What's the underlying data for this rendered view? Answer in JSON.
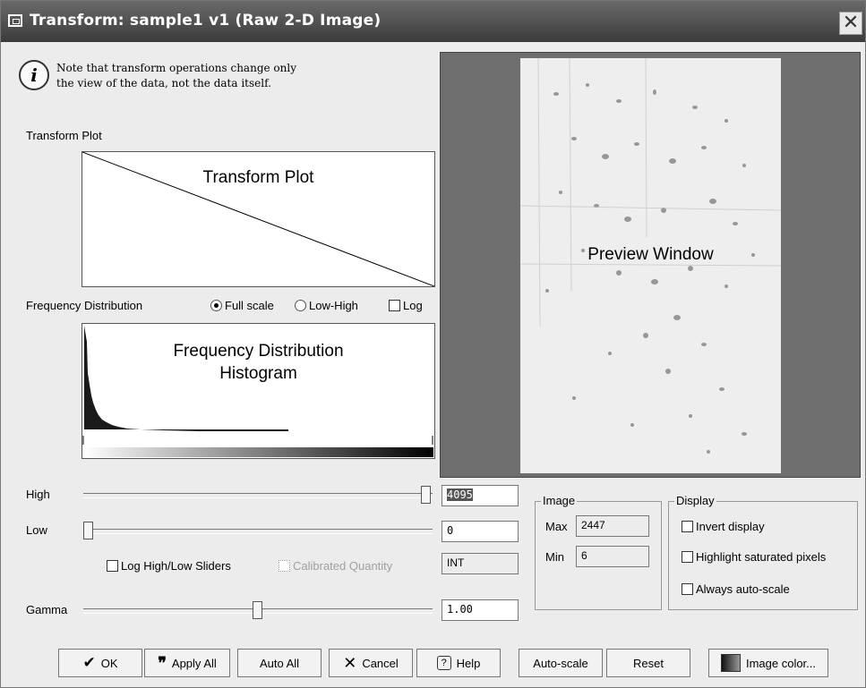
{
  "window": {
    "title": "Transform: sample1 v1 (Raw 2-D Image)",
    "close_glyph": "✕"
  },
  "note": {
    "icon": "info-icon",
    "icon_glyph": "i",
    "line1": "Note that transform operations change only",
    "line2": "the view of the data, not the data itself."
  },
  "transform_plot": {
    "label": "Transform Plot",
    "overlay": "Transform Plot"
  },
  "frequency": {
    "label": "Frequency Distribution",
    "radio_full": "Full scale",
    "radio_lowhigh": "Low-High",
    "log_label": "Log",
    "overlay_line1": "Frequency Distribution",
    "overlay_line2": "Histogram"
  },
  "preview": {
    "overlay": "Preview Window"
  },
  "controls": {
    "high_label": "High",
    "high_value": "4095",
    "high_level": 1.0,
    "low_label": "Low",
    "low_value": "0",
    "low_level": 0.0,
    "log_sliders_label": "Log High/Low Sliders",
    "calibrated_label": "Calibrated Quantity",
    "quantity_value": "INT",
    "gamma_label": "Gamma",
    "gamma_value": "1.00"
  },
  "image_group": {
    "title": "Image",
    "max_label": "Max",
    "max_value": "2447",
    "min_label": "Min",
    "min_value": "6"
  },
  "display_group": {
    "title": "Display",
    "invert": "Invert display",
    "highlight": "Highlight saturated pixels",
    "autoscale": "Always auto-scale"
  },
  "buttons": {
    "ok": "OK",
    "apply_all": "Apply All",
    "auto_all": "Auto All",
    "cancel": "Cancel",
    "help": "Help",
    "auto_scale": "Auto-scale",
    "reset": "Reset",
    "image_color": "Image color..."
  },
  "colors": {
    "titlebar": "#4a4a4a",
    "preview_frame": "#6e6e6e",
    "histogram": "#1a1a1a"
  }
}
